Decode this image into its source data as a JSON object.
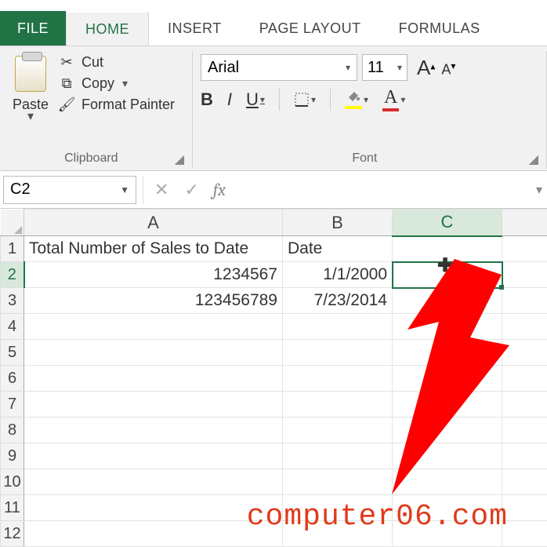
{
  "tabs": {
    "file": "FILE",
    "home": "HOME",
    "insert": "INSERT",
    "page_layout": "PAGE LAYOUT",
    "formulas": "FORMULAS"
  },
  "clipboard": {
    "paste": "Paste",
    "cut": "Cut",
    "copy": "Copy",
    "format_painter": "Format Painter",
    "group_label": "Clipboard"
  },
  "font": {
    "name": "Arial",
    "size": "11",
    "bold": "B",
    "italic": "I",
    "underline": "U",
    "group_label": "Font"
  },
  "name_box": "C2",
  "fx_label": "fx",
  "columns": [
    "A",
    "B",
    "C"
  ],
  "row_headers": [
    "1",
    "2",
    "3",
    "4",
    "5",
    "6",
    "7",
    "8",
    "9",
    "10",
    "11",
    "12"
  ],
  "cells": {
    "A1": "Total Number of Sales to Date",
    "B1": "Date",
    "A2": "1234567",
    "B2": "1/1/2000",
    "A3": "123456789",
    "B3": "7/23/2014"
  },
  "active_cell": "C2",
  "watermark": "computer06.com"
}
